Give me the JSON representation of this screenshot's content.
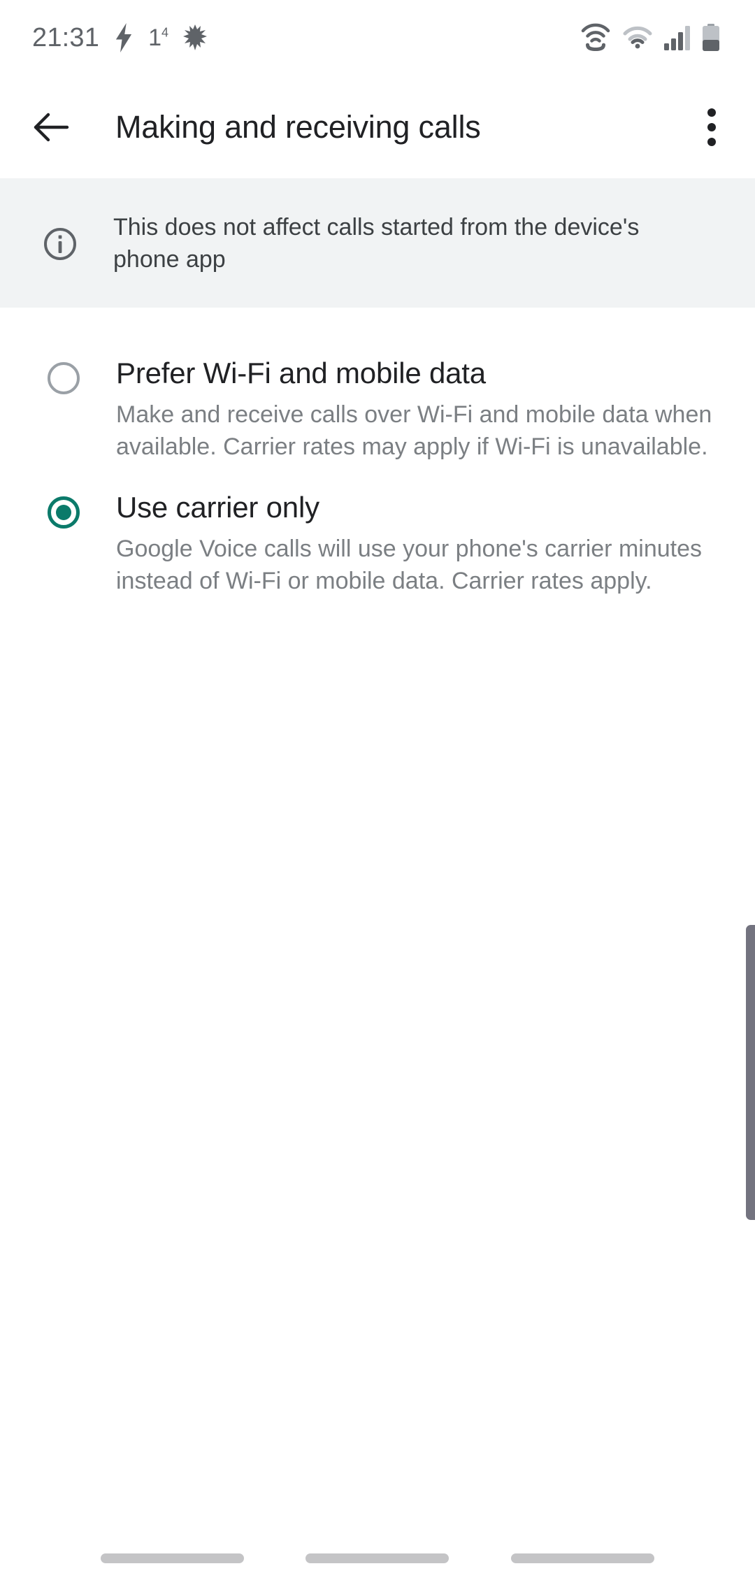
{
  "status_bar": {
    "clock": "21:31",
    "left_icons": [
      "lightning-bolt-icon",
      "notification-count-icon",
      "burst-icon"
    ],
    "notification_count": "1",
    "notification_superscript": "4",
    "right_icons": [
      "wifi-calling-icon",
      "wifi-icon",
      "cellular-signal-icon",
      "battery-icon"
    ]
  },
  "app_bar": {
    "back_label": "Back",
    "title": "Making and receiving calls",
    "overflow_label": "More options"
  },
  "banner": {
    "icon": "info-icon",
    "text": "This does not affect calls started from the device's phone app"
  },
  "options": [
    {
      "id": "prefer-wifi-and-mobile-data",
      "title": "Prefer Wi-Fi and mobile data",
      "description": "Make and receive calls over Wi-Fi and mobile data when available. Carrier rates may apply if Wi-Fi is unavailable.",
      "selected": false
    },
    {
      "id": "use-carrier-only",
      "title": "Use carrier only",
      "description": "Google Voice calls will use your phone's carrier minutes instead of Wi-Fi or mobile data. Carrier rates apply.",
      "selected": true
    }
  ],
  "colors": {
    "accent": "#0b7a6a",
    "banner_bg": "#f1f3f4",
    "primary_text": "#202124",
    "secondary_text": "#7b7f83",
    "status_text": "#5f6368",
    "scrollbar": "#73737f",
    "nav_pill": "#c4c4c6"
  },
  "nav_bar": {
    "pills": [
      "nav-pill-left",
      "nav-pill-center",
      "nav-pill-right"
    ]
  }
}
